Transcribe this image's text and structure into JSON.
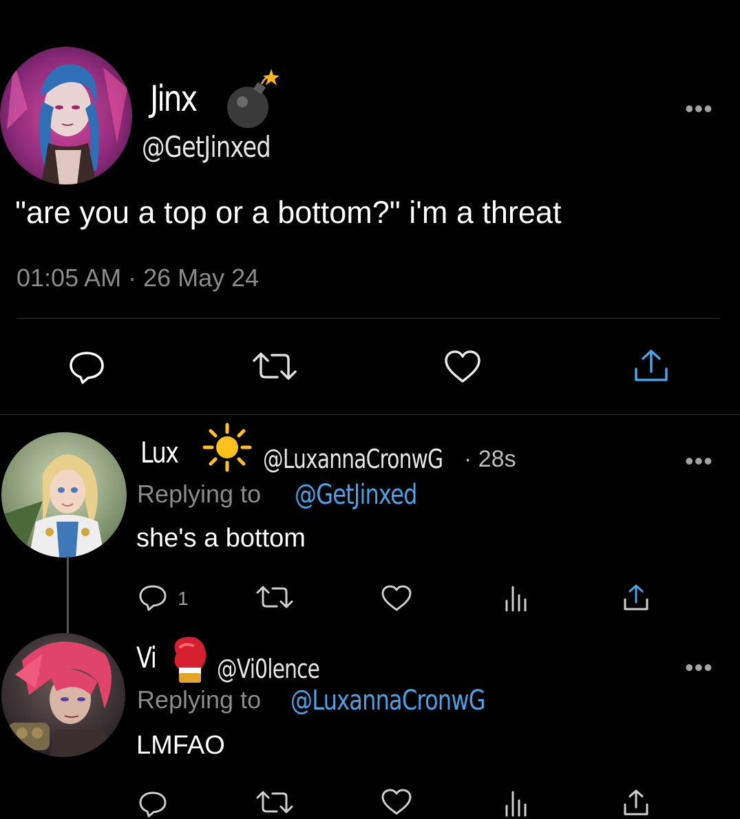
{
  "main_tweet": {
    "name": "Jinx",
    "name_emoji": "bomb-icon",
    "handle": "@GetJinxed",
    "text": "\"are you a top or a bottom?\" i'm a threat",
    "timestamp": "01:05 AM · 26 May 24",
    "actions": [
      "reply-icon",
      "retweet-icon",
      "like-icon",
      "share-icon"
    ]
  },
  "replies": [
    {
      "name": "Lux",
      "name_emoji": "sun-icon",
      "handle": "@LuxannaCronwG",
      "time": "· 28s",
      "replying_prefix": "Replying to",
      "replying_to": "@GetJinxed",
      "text": "she's a bottom",
      "reply_count": "1",
      "actions": [
        "reply-icon",
        "retweet-icon",
        "like-icon",
        "views-icon",
        "share-icon"
      ]
    },
    {
      "name": "Vi",
      "name_emoji": "boxing-glove-icon",
      "handle": "@Vi0lence",
      "replying_prefix": "Replying to",
      "replying_to": "@LuxannaCronwG",
      "text": "LMFAO",
      "actions": [
        "reply-icon",
        "retweet-icon",
        "like-icon",
        "views-icon",
        "share-icon"
      ]
    }
  ],
  "colors": {
    "background": "#000000",
    "text_primary": "#ffffff",
    "text_secondary": "#8b8b8b",
    "link": "#4aa3e6",
    "divider": "#333333"
  }
}
